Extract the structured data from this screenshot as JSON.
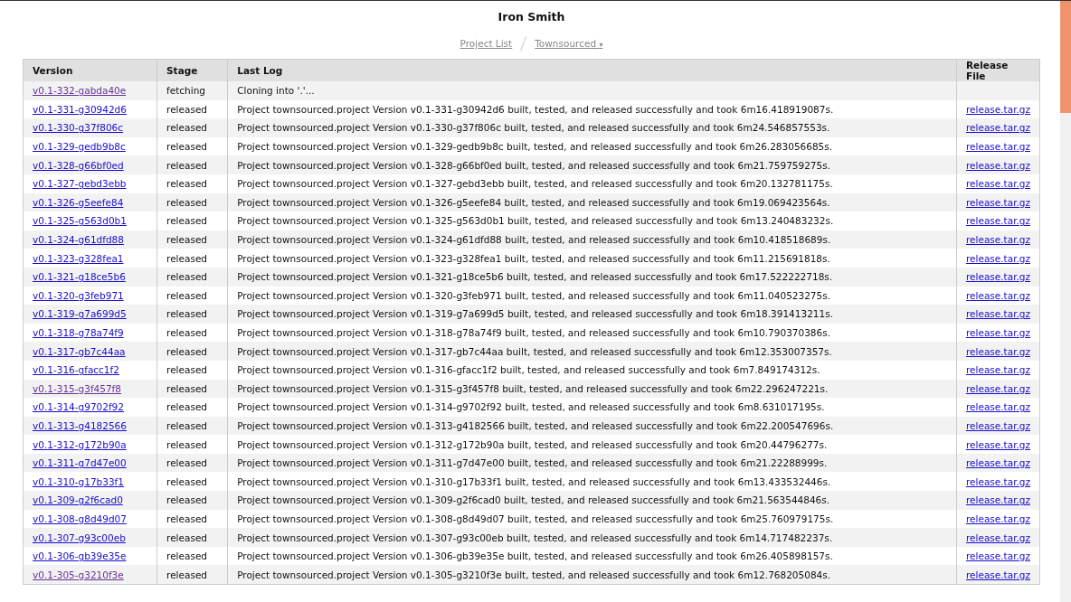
{
  "title": "Iron Smith",
  "breadcrumb": {
    "project_list": "Project List",
    "current": "Townsourced",
    "caret": "▾"
  },
  "table": {
    "columns": [
      "Version",
      "Stage",
      "Last Log",
      "Release File"
    ],
    "rows": [
      {
        "version": "v0.1-332-gabda40e",
        "visited": true,
        "stage": "fetching",
        "log": "Cloning into '.'..."
      },
      {
        "version": "v0.1-331-g30942d6",
        "visited": false,
        "stage": "released",
        "log": "Project townsourced.project Version v0.1-331-g30942d6 built, tested, and released successfully and took 6m16.418919087s.",
        "file": "release.tar.gz"
      },
      {
        "version": "v0.1-330-g37f806c",
        "visited": false,
        "stage": "released",
        "log": "Project townsourced.project Version v0.1-330-g37f806c built, tested, and released successfully and took 6m24.546857553s.",
        "file": "release.tar.gz"
      },
      {
        "version": "v0.1-329-gedb9b8c",
        "visited": false,
        "stage": "released",
        "log": "Project townsourced.project Version v0.1-329-gedb9b8c built, tested, and released successfully and took 6m26.283056685s.",
        "file": "release.tar.gz"
      },
      {
        "version": "v0.1-328-g66bf0ed",
        "visited": false,
        "stage": "released",
        "log": "Project townsourced.project Version v0.1-328-g66bf0ed built, tested, and released successfully and took 6m21.759759275s.",
        "file": "release.tar.gz"
      },
      {
        "version": "v0.1-327-gebd3ebb",
        "visited": false,
        "stage": "released",
        "log": "Project townsourced.project Version v0.1-327-gebd3ebb built, tested, and released successfully and took 6m20.132781175s.",
        "file": "release.tar.gz"
      },
      {
        "version": "v0.1-326-g5eefe84",
        "visited": false,
        "stage": "released",
        "log": "Project townsourced.project Version v0.1-326-g5eefe84 built, tested, and released successfully and took 6m19.069423564s.",
        "file": "release.tar.gz"
      },
      {
        "version": "v0.1-325-g563d0b1",
        "visited": false,
        "stage": "released",
        "log": "Project townsourced.project Version v0.1-325-g563d0b1 built, tested, and released successfully and took 6m13.240483232s.",
        "file": "release.tar.gz"
      },
      {
        "version": "v0.1-324-g61dfd88",
        "visited": false,
        "stage": "released",
        "log": "Project townsourced.project Version v0.1-324-g61dfd88 built, tested, and released successfully and took 6m10.418518689s.",
        "file": "release.tar.gz"
      },
      {
        "version": "v0.1-323-g328fea1",
        "visited": false,
        "stage": "released",
        "log": "Project townsourced.project Version v0.1-323-g328fea1 built, tested, and released successfully and took 6m11.215691818s.",
        "file": "release.tar.gz"
      },
      {
        "version": "v0.1-321-g18ce5b6",
        "visited": false,
        "stage": "released",
        "log": "Project townsourced.project Version v0.1-321-g18ce5b6 built, tested, and released successfully and took 6m17.522222718s.",
        "file": "release.tar.gz"
      },
      {
        "version": "v0.1-320-g3feb971",
        "visited": false,
        "stage": "released",
        "log": "Project townsourced.project Version v0.1-320-g3feb971 built, tested, and released successfully and took 6m11.040523275s.",
        "file": "release.tar.gz"
      },
      {
        "version": "v0.1-319-g7a699d5",
        "visited": false,
        "stage": "released",
        "log": "Project townsourced.project Version v0.1-319-g7a699d5 built, tested, and released successfully and took 6m18.391413211s.",
        "file": "release.tar.gz"
      },
      {
        "version": "v0.1-318-g78a74f9",
        "visited": false,
        "stage": "released",
        "log": "Project townsourced.project Version v0.1-318-g78a74f9 built, tested, and released successfully and took 6m10.790370386s.",
        "file": "release.tar.gz"
      },
      {
        "version": "v0.1-317-gb7c44aa",
        "visited": false,
        "stage": "released",
        "log": "Project townsourced.project Version v0.1-317-gb7c44aa built, tested, and released successfully and took 6m12.353007357s.",
        "file": "release.tar.gz"
      },
      {
        "version": "v0.1-316-gfacc1f2",
        "visited": false,
        "stage": "released",
        "log": "Project townsourced.project Version v0.1-316-gfacc1f2 built, tested, and released successfully and took 6m7.849174312s.",
        "file": "release.tar.gz"
      },
      {
        "version": "v0.1-315-g3f457f8",
        "visited": true,
        "stage": "released",
        "log": "Project townsourced.project Version v0.1-315-g3f457f8 built, tested, and released successfully and took 6m22.296247221s.",
        "file": "release.tar.gz"
      },
      {
        "version": "v0.1-314-g9702f92",
        "visited": false,
        "stage": "released",
        "log": "Project townsourced.project Version v0.1-314-g9702f92 built, tested, and released successfully and took 6m8.631017195s.",
        "file": "release.tar.gz"
      },
      {
        "version": "v0.1-313-g4182566",
        "visited": false,
        "stage": "released",
        "log": "Project townsourced.project Version v0.1-313-g4182566 built, tested, and released successfully and took 6m22.200547696s.",
        "file": "release.tar.gz"
      },
      {
        "version": "v0.1-312-g172b90a",
        "visited": false,
        "stage": "released",
        "log": "Project townsourced.project Version v0.1-312-g172b90a built, tested, and released successfully and took 6m20.44796277s.",
        "file": "release.tar.gz"
      },
      {
        "version": "v0.1-311-g7d47e00",
        "visited": false,
        "stage": "released",
        "log": "Project townsourced.project Version v0.1-311-g7d47e00 built, tested, and released successfully and took 6m21.22288999s.",
        "file": "release.tar.gz"
      },
      {
        "version": "v0.1-310-g17b33f1",
        "visited": false,
        "stage": "released",
        "log": "Project townsourced.project Version v0.1-310-g17b33f1 built, tested, and released successfully and took 6m13.433532446s.",
        "file": "release.tar.gz"
      },
      {
        "version": "v0.1-309-g2f6cad0",
        "visited": false,
        "stage": "released",
        "log": "Project townsourced.project Version v0.1-309-g2f6cad0 built, tested, and released successfully and took 6m21.563544846s.",
        "file": "release.tar.gz"
      },
      {
        "version": "v0.1-308-g8d49d07",
        "visited": false,
        "stage": "released",
        "log": "Project townsourced.project Version v0.1-308-g8d49d07 built, tested, and released successfully and took 6m25.760979175s.",
        "file": "release.tar.gz"
      },
      {
        "version": "v0.1-307-g93c00eb",
        "visited": false,
        "stage": "released",
        "log": "Project townsourced.project Version v0.1-307-g93c00eb built, tested, and released successfully and took 6m14.717482237s.",
        "file": "release.tar.gz"
      },
      {
        "version": "v0.1-306-gb39e35e",
        "visited": false,
        "stage": "released",
        "log": "Project townsourced.project Version v0.1-306-gb39e35e built, tested, and released successfully and took 6m26.405898157s.",
        "file": "release.tar.gz"
      },
      {
        "version": "v0.1-305-g3210f3e",
        "visited": true,
        "stage": "released",
        "log": "Project townsourced.project Version v0.1-305-g3210f3e built, tested, and released successfully and took 6m12.768205084s.",
        "file": "release.tar.gz"
      }
    ]
  }
}
